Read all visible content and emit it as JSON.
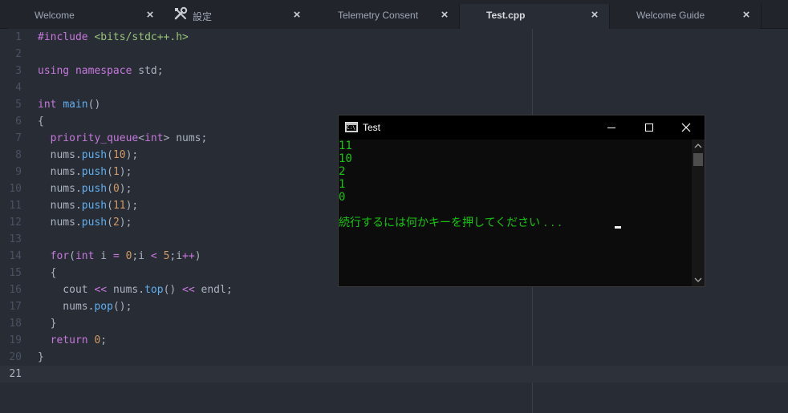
{
  "tabs": [
    {
      "label": "Welcome",
      "active": false,
      "icon": ""
    },
    {
      "label": "設定",
      "active": false,
      "icon": "tools-icon"
    },
    {
      "label": "Telemetry Consent",
      "active": false,
      "icon": ""
    },
    {
      "label": "Test.cpp",
      "active": true,
      "icon": ""
    },
    {
      "label": "Welcome Guide",
      "active": false,
      "icon": ""
    }
  ],
  "tab_close_glyph": "×",
  "editor": {
    "cursor_line": 21,
    "lines": [
      [
        {
          "t": "#include ",
          "c": "k"
        },
        {
          "t": "<bits/stdc++.h>",
          "c": "s"
        }
      ],
      [],
      [
        {
          "t": "using ",
          "c": "k"
        },
        {
          "t": "namespace ",
          "c": "k"
        },
        {
          "t": "std;",
          "c": "p"
        }
      ],
      [],
      [
        {
          "t": "int ",
          "c": "k"
        },
        {
          "t": "main",
          "c": "f"
        },
        {
          "t": "()",
          "c": "p"
        }
      ],
      [
        {
          "t": "{",
          "c": "p"
        }
      ],
      [
        {
          "t": "  priority_queue",
          "c": "k"
        },
        {
          "t": "<",
          "c": "p"
        },
        {
          "t": "int",
          "c": "k"
        },
        {
          "t": "> nums;",
          "c": "p"
        }
      ],
      [
        {
          "t": "  nums.",
          "c": "p"
        },
        {
          "t": "push",
          "c": "f"
        },
        {
          "t": "(",
          "c": "p"
        },
        {
          "t": "10",
          "c": "n"
        },
        {
          "t": ");",
          "c": "p"
        }
      ],
      [
        {
          "t": "  nums.",
          "c": "p"
        },
        {
          "t": "push",
          "c": "f"
        },
        {
          "t": "(",
          "c": "p"
        },
        {
          "t": "1",
          "c": "n"
        },
        {
          "t": ");",
          "c": "p"
        }
      ],
      [
        {
          "t": "  nums.",
          "c": "p"
        },
        {
          "t": "push",
          "c": "f"
        },
        {
          "t": "(",
          "c": "p"
        },
        {
          "t": "0",
          "c": "n"
        },
        {
          "t": ");",
          "c": "p"
        }
      ],
      [
        {
          "t": "  nums.",
          "c": "p"
        },
        {
          "t": "push",
          "c": "f"
        },
        {
          "t": "(",
          "c": "p"
        },
        {
          "t": "11",
          "c": "n"
        },
        {
          "t": ");",
          "c": "p"
        }
      ],
      [
        {
          "t": "  nums.",
          "c": "p"
        },
        {
          "t": "push",
          "c": "f"
        },
        {
          "t": "(",
          "c": "p"
        },
        {
          "t": "2",
          "c": "n"
        },
        {
          "t": ");",
          "c": "p"
        }
      ],
      [],
      [
        {
          "t": "  for",
          "c": "k"
        },
        {
          "t": "(",
          "c": "p"
        },
        {
          "t": "int ",
          "c": "k"
        },
        {
          "t": "i ",
          "c": "p"
        },
        {
          "t": "= ",
          "c": "k"
        },
        {
          "t": "0",
          "c": "n"
        },
        {
          "t": ";i ",
          "c": "p"
        },
        {
          "t": "< ",
          "c": "k"
        },
        {
          "t": "5",
          "c": "n"
        },
        {
          "t": ";i",
          "c": "p"
        },
        {
          "t": "++",
          "c": "k"
        },
        {
          "t": ")",
          "c": "p"
        }
      ],
      [
        {
          "t": "  {",
          "c": "p"
        }
      ],
      [
        {
          "t": "    cout ",
          "c": "p"
        },
        {
          "t": "<< ",
          "c": "k"
        },
        {
          "t": "nums.",
          "c": "p"
        },
        {
          "t": "top",
          "c": "f"
        },
        {
          "t": "() ",
          "c": "p"
        },
        {
          "t": "<< ",
          "c": "k"
        },
        {
          "t": "endl;",
          "c": "p"
        }
      ],
      [
        {
          "t": "    nums.",
          "c": "p"
        },
        {
          "t": "pop",
          "c": "f"
        },
        {
          "t": "();",
          "c": "p"
        }
      ],
      [
        {
          "t": "  }",
          "c": "p"
        }
      ],
      [
        {
          "t": "  return ",
          "c": "k"
        },
        {
          "t": "0",
          "c": "n"
        },
        {
          "t": ";",
          "c": "p"
        }
      ],
      [
        {
          "t": "}",
          "c": "p"
        }
      ],
      []
    ]
  },
  "console": {
    "title": "Test",
    "icon_text": "C:\\",
    "output_lines": [
      "11",
      "10",
      "2",
      "1",
      "0"
    ],
    "prompt": "続行するには何かキーを押してください . . . ",
    "text_color": "#16c60c"
  },
  "colors": {
    "editor_bg": "#282c34",
    "tabbar_bg": "#21252b",
    "keyword": "#c678dd",
    "function": "#61afef",
    "number": "#d19a66",
    "string": "#98c379"
  }
}
